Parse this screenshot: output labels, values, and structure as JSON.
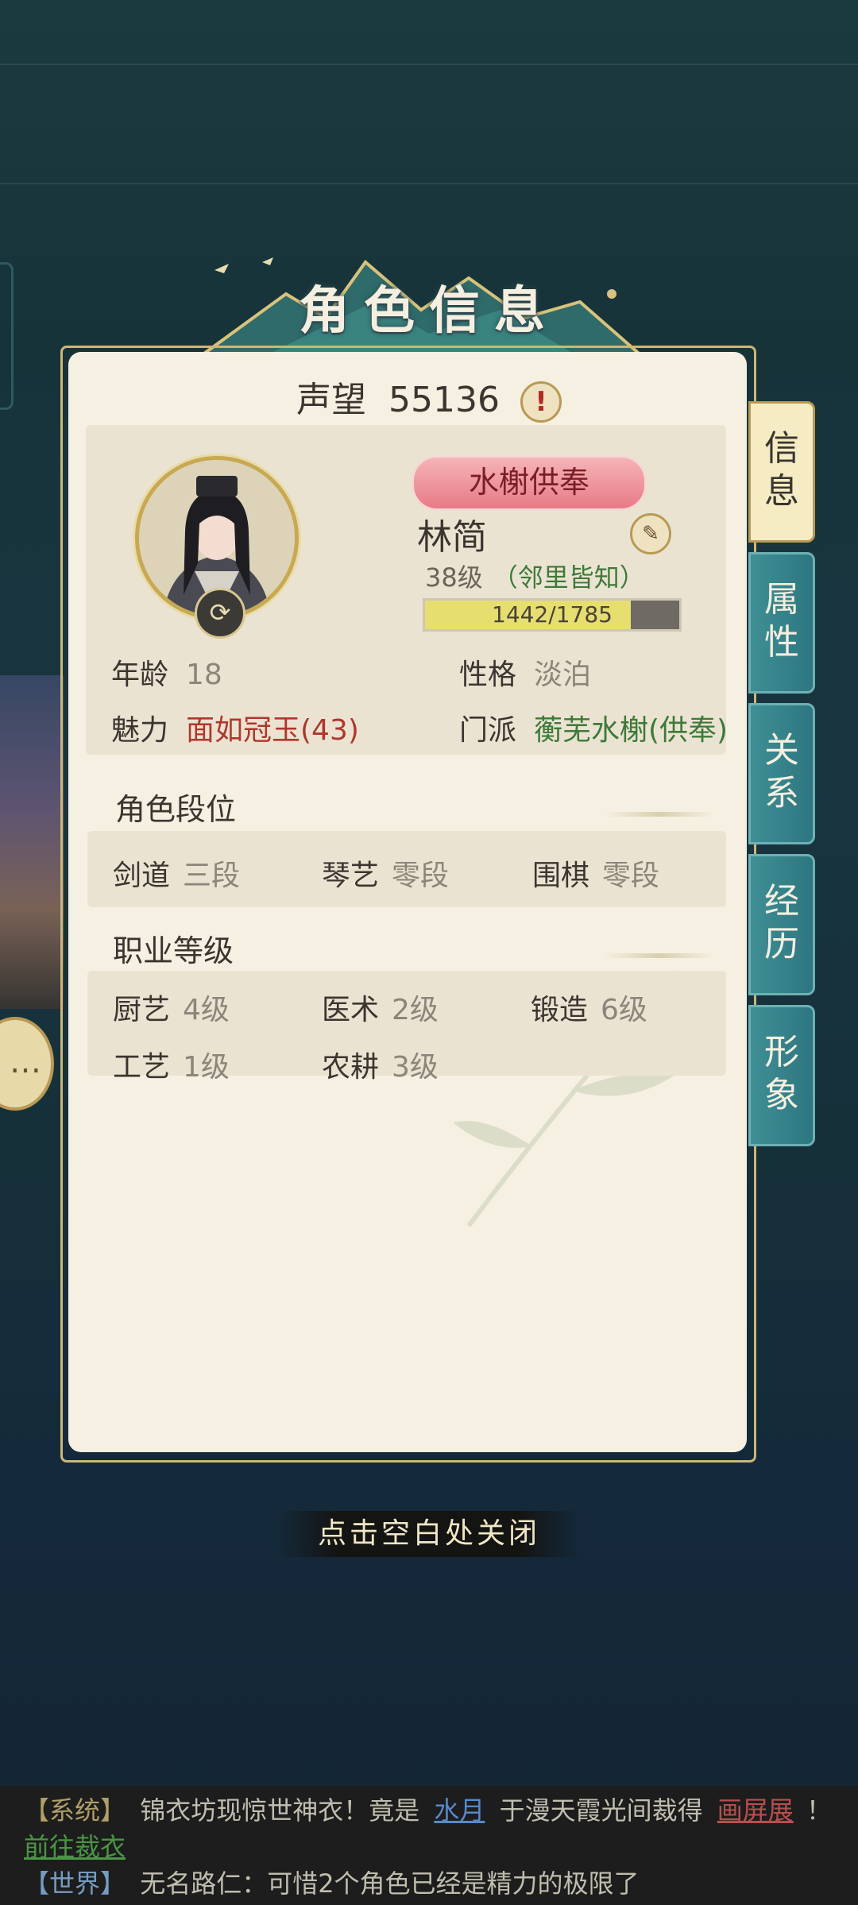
{
  "window": {
    "title": "角色信息"
  },
  "fame": {
    "label": "声望",
    "value": "55136",
    "alert_icon": "!"
  },
  "character": {
    "title_badge": "水榭供奉",
    "name": "林简",
    "level": "38级",
    "level_tag": "（邻里皆知）",
    "exp_current": 1442,
    "exp_max": 1785,
    "exp_text": "1442/1785",
    "exp_fraction": 0.808
  },
  "attributes": {
    "age_label": "年龄",
    "age_value": "18",
    "personality_label": "性格",
    "personality_value": "淡泊",
    "charm_label": "魅力",
    "charm_value": "面如冠玉(43)",
    "sect_label": "门派",
    "sect_value": "蘅芜水榭(供奉)"
  },
  "rank_section": {
    "title": "角色段位",
    "items": [
      {
        "label": "剑道",
        "value": "三段"
      },
      {
        "label": "琴艺",
        "value": "零段"
      },
      {
        "label": "围棋",
        "value": "零段"
      }
    ]
  },
  "job_section": {
    "title": "职业等级",
    "items": [
      {
        "label": "厨艺",
        "value": "4级"
      },
      {
        "label": "医术",
        "value": "2级"
      },
      {
        "label": "锻造",
        "value": "6级"
      },
      {
        "label": "工艺",
        "value": "1级"
      },
      {
        "label": "农耕",
        "value": "3级"
      }
    ]
  },
  "tabs": [
    {
      "label_top": "信",
      "label_bottom": "息",
      "active": true
    },
    {
      "label_top": "属",
      "label_bottom": "性",
      "active": false
    },
    {
      "label_top": "关",
      "label_bottom": "系",
      "active": false
    },
    {
      "label_top": "经",
      "label_bottom": "历",
      "active": false
    },
    {
      "label_top": "形",
      "label_bottom": "象",
      "active": false
    }
  ],
  "close_hint": "点击空白处关闭",
  "chat": {
    "line1": {
      "channel": "【系统】",
      "text_a": "锦衣坊现惊世神衣！竟是",
      "user": "水月",
      "text_b": "于漫天霞光间裁得",
      "item": "画屏展",
      "text_c": "！"
    },
    "line2": {
      "link": "前往裁衣"
    },
    "line3": {
      "channel": "【世界】",
      "text": "无名路仁：可惜2个角色已经是精力的极限了"
    }
  },
  "colors": {
    "accent_gold": "#c8a952",
    "tab_teal": "#2e7680",
    "badge_pink": "#e87a86",
    "exp_fill": "#e6df6f"
  }
}
